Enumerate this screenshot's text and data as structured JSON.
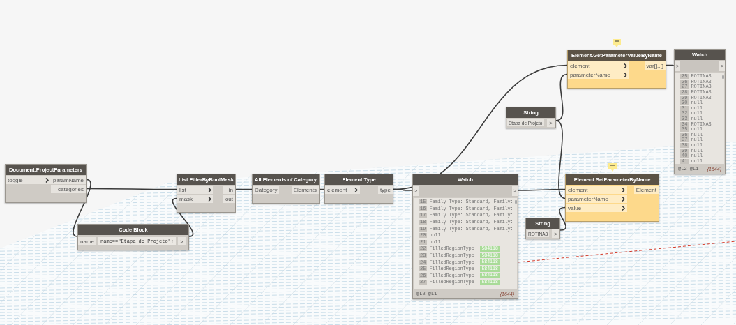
{
  "nodes": [
    {
      "kind": "function",
      "title": "Document.ProjectParameters",
      "selected": false,
      "has_note": false,
      "port_arrows": true,
      "inputs": [
        "toggle"
      ],
      "outputs": [
        "paramName",
        "categories"
      ]
    },
    {
      "kind": "code",
      "title": "Code Block",
      "selected": false,
      "has_note": false,
      "inputs": [
        "name"
      ],
      "code": "name==\"Etapa de Projeto\";",
      "output_port": ">"
    },
    {
      "kind": "function",
      "title": "List.FilterByBoolMask",
      "selected": false,
      "has_note": false,
      "port_arrows": true,
      "inputs": [
        "list",
        "mask"
      ],
      "outputs": [
        "in",
        "out"
      ]
    },
    {
      "kind": "function",
      "title": "All Elements of Category",
      "selected": false,
      "has_note": false,
      "port_arrows": false,
      "inputs": [
        "Category"
      ],
      "outputs": [
        "Elements"
      ]
    },
    {
      "kind": "function",
      "title": "Element.Type",
      "selected": false,
      "has_note": false,
      "port_arrows": true,
      "inputs": [
        "element"
      ],
      "outputs": [
        "type"
      ]
    },
    {
      "kind": "watch",
      "title": "Watch",
      "selected": false,
      "has_note": false,
      "input_port": ">",
      "output_port": ">",
      "levels": "@L2 @L1",
      "count": "{1644}",
      "rows": [
        {
          "index": "15",
          "text": "Family Type: Standard, Family:"
        },
        {
          "index": "16",
          "text": "Family Type: Standard, Family:"
        },
        {
          "index": "17",
          "text": "Family Type: Standard, Family:"
        },
        {
          "index": "18",
          "text": "Family Type: Standard, Family:"
        },
        {
          "index": "19",
          "text": "Family Type: Standard, Family:"
        },
        {
          "index": "20",
          "text": "null"
        },
        {
          "index": "21",
          "text": "null"
        },
        {
          "index": "22",
          "text": "FilledRegionType",
          "value": "584118"
        },
        {
          "index": "23",
          "text": "FilledRegionType",
          "value": "584118"
        },
        {
          "index": "24",
          "text": "FilledRegionType",
          "value": "584118"
        },
        {
          "index": "25",
          "text": "FilledRegionType",
          "value": "584118"
        },
        {
          "index": "26",
          "text": "FilledRegionType",
          "value": "584118"
        },
        {
          "index": "27",
          "text": "FilledRegionType",
          "value": "584118"
        }
      ]
    },
    {
      "kind": "string",
      "title": "String",
      "selected": false,
      "has_note": false,
      "value": "Etapa de Projeto",
      "output_port": ">"
    },
    {
      "kind": "function",
      "title": "Element.GetParameterValueByName",
      "selected": true,
      "has_note": true,
      "port_arrows": true,
      "inputs": [
        "element",
        "parameterName"
      ],
      "outputs": [
        "var[]..[]"
      ]
    },
    {
      "kind": "watch",
      "title": "Watch",
      "selected": false,
      "has_note": false,
      "input_port": ">",
      "output_port": ">",
      "levels": "@L2 @L1",
      "count": "{1644}",
      "rows": [
        {
          "index": "25",
          "text": "ROTINA3"
        },
        {
          "index": "26",
          "text": "ROTINA3"
        },
        {
          "index": "27",
          "text": "ROTINA3"
        },
        {
          "index": "28",
          "text": "ROTINA3"
        },
        {
          "index": "29",
          "text": "ROTINA3"
        },
        {
          "index": "30",
          "text": "null"
        },
        {
          "index": "31",
          "text": "null"
        },
        {
          "index": "32",
          "text": "null"
        },
        {
          "index": "33",
          "text": "null"
        },
        {
          "index": "34",
          "text": "ROTINA3"
        },
        {
          "index": "35",
          "text": "null"
        },
        {
          "index": "36",
          "text": "null"
        },
        {
          "index": "37",
          "text": "null"
        },
        {
          "index": "38",
          "text": "null"
        },
        {
          "index": "39",
          "text": "null"
        },
        {
          "index": "40",
          "text": "null"
        },
        {
          "index": "41",
          "text": "null"
        }
      ]
    },
    {
      "kind": "function",
      "title": "Element.SetParameterByName",
      "selected": true,
      "has_note": true,
      "port_arrows": true,
      "inputs": [
        "element",
        "parameterName",
        "value"
      ],
      "outputs": [
        "Element"
      ]
    },
    {
      "kind": "string",
      "title": "String",
      "selected": false,
      "has_note": false,
      "value": "ROTINA3",
      "output_port": ">"
    }
  ]
}
